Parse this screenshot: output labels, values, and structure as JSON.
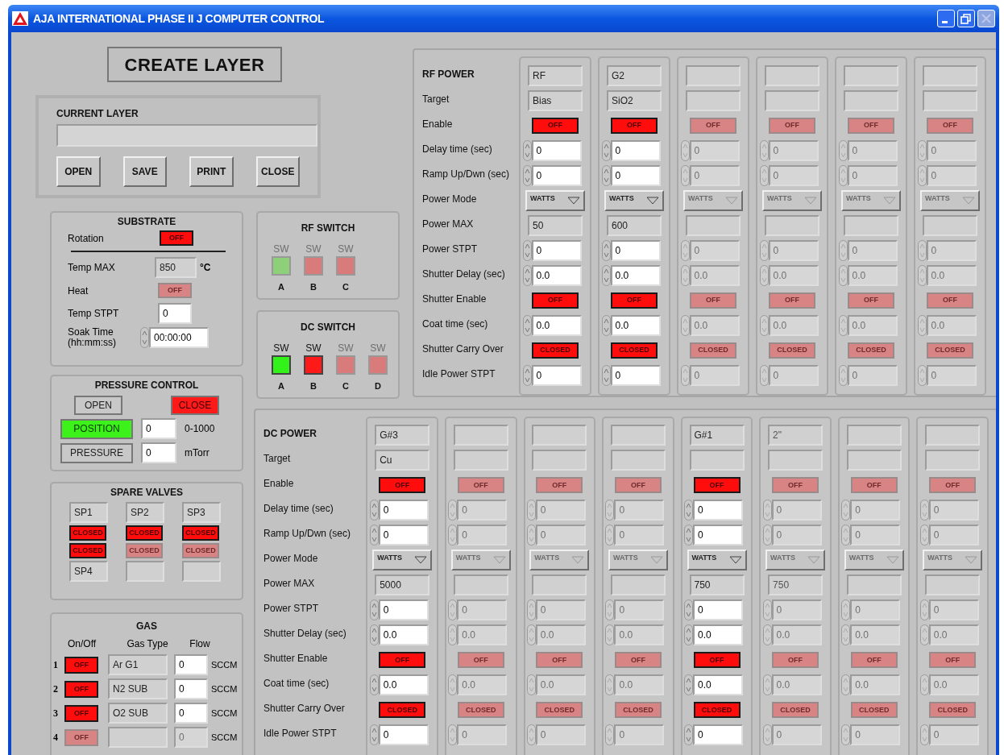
{
  "window": {
    "title": "AJA INTERNATIONAL PHASE II J COMPUTER CONTROL",
    "controls": [
      {
        "kind": "minimize",
        "enabled": true
      },
      {
        "kind": "restore",
        "enabled": true
      },
      {
        "kind": "close",
        "enabled": false
      }
    ]
  },
  "layer": {
    "title": "CREATE LAYER",
    "current_label": "CURRENT LAYER",
    "buttons": [
      "OPEN",
      "SAVE",
      "PRINT",
      "CLOSE"
    ]
  },
  "substrate": {
    "title": "SUBSTRATE",
    "rotation": {
      "label": "Rotation",
      "value": "OFF",
      "enabled": true
    },
    "temp_max": {
      "label": "Temp MAX",
      "value": "850",
      "unit": "°C"
    },
    "heat": {
      "label": "Heat",
      "value": "OFF",
      "enabled": false
    },
    "temp_stpt": {
      "label": "Temp STPT",
      "value": "0"
    },
    "soak_time": {
      "label": "Soak Time (hh:mm:ss)",
      "value": "00:00:00"
    }
  },
  "rf_switch": {
    "title": "RF SWITCH",
    "switches": [
      {
        "top": "SW",
        "letter": "A",
        "on": true,
        "enabled": false
      },
      {
        "top": "SW",
        "letter": "B",
        "on": false,
        "enabled": false
      },
      {
        "top": "SW",
        "letter": "C",
        "on": false,
        "enabled": false
      }
    ]
  },
  "dc_switch": {
    "title": "DC SWITCH",
    "switches": [
      {
        "top": "SW",
        "letter": "A",
        "on": true,
        "enabled": true
      },
      {
        "top": "SW",
        "letter": "B",
        "on": false,
        "enabled": true
      },
      {
        "top": "SW",
        "letter": "C",
        "on": false,
        "enabled": false
      },
      {
        "top": "SW",
        "letter": "D",
        "on": false,
        "enabled": false
      }
    ]
  },
  "pressure": {
    "title": "PRESSURE CONTROL",
    "valve_buttons": [
      {
        "label": "OPEN",
        "selected": false
      },
      {
        "label": "CLOSE",
        "selected": true
      }
    ],
    "modes": [
      {
        "label": "POSITION",
        "selected": true,
        "value": "0",
        "unit": "0-1000"
      },
      {
        "label": "PRESSURE",
        "selected": false,
        "value": "0",
        "unit": "mTorr"
      }
    ]
  },
  "spare_valves": {
    "title": "SPARE VALVES",
    "items": [
      {
        "kind": "field",
        "value": "SP1"
      },
      {
        "kind": "field",
        "value": "SP2"
      },
      {
        "kind": "field",
        "value": "SP3"
      },
      {
        "kind": "toggle",
        "value": "CLOSED",
        "enabled": true
      },
      {
        "kind": "toggle",
        "value": "CLOSED",
        "enabled": true
      },
      {
        "kind": "toggle",
        "value": "CLOSED",
        "enabled": true
      },
      {
        "kind": "toggle",
        "value": "CLOSED",
        "enabled": true
      },
      {
        "kind": "toggle",
        "value": "CLOSED",
        "enabled": false
      },
      {
        "kind": "toggle",
        "value": "CLOSED",
        "enabled": false
      },
      {
        "kind": "field",
        "value": "SP4"
      },
      {
        "kind": "field"
      },
      {
        "kind": "field"
      }
    ]
  },
  "gas": {
    "title": "GAS",
    "headers": [
      "On/Off",
      "Gas Type",
      "Flow"
    ],
    "rows": [
      {
        "number": "1",
        "switch": "OFF",
        "enabled": true,
        "gas_type": "Ar G1",
        "flow": "0",
        "unit": "SCCM"
      },
      {
        "number": "2",
        "switch": "OFF",
        "enabled": true,
        "gas_type": "N2 SUB",
        "flow": "0",
        "unit": "SCCM"
      },
      {
        "number": "3",
        "switch": "OFF",
        "enabled": true,
        "gas_type": "O2 SUB",
        "flow": "0",
        "unit": "SCCM"
      },
      {
        "number": "4",
        "switch": "OFF",
        "enabled": false,
        "flow": "0",
        "unit": "SCCM"
      }
    ]
  },
  "rf_power": {
    "rows": [
      {
        "label": "RF POWER",
        "kind": "name"
      },
      {
        "label": "Target",
        "kind": "text"
      },
      {
        "label": "Enable",
        "kind": "toggle"
      },
      {
        "label": "Delay time (sec)",
        "kind": "spin"
      },
      {
        "label": "Ramp Up/Dwn (sec)",
        "kind": "spin"
      },
      {
        "label": "Power Mode",
        "kind": "dropdown"
      },
      {
        "label": "Power MAX",
        "kind": "text"
      },
      {
        "label": "Power STPT",
        "kind": "spin"
      },
      {
        "label": "Shutter Delay (sec)",
        "kind": "spin"
      },
      {
        "label": "Shutter Enable",
        "kind": "toggle"
      },
      {
        "label": "Coat time (sec)",
        "kind": "spin"
      },
      {
        "label": "Shutter Carry Over",
        "kind": "toggle"
      },
      {
        "label": "Idle Power STPT",
        "kind": "spin"
      }
    ],
    "columns": [
      {
        "enabled": true,
        "name": "RF",
        "target": "Bias",
        "enable": "OFF",
        "delay": "0",
        "ramp": "0",
        "mode": "WATTS",
        "power_max": "50",
        "power_stpt": "0",
        "shutter_delay": "0.0",
        "shutter_enable": "OFF",
        "coat_time": "0.0",
        "carry_over": "CLOSED",
        "idle_stpt": "0"
      },
      {
        "enabled": true,
        "name": "G2",
        "target": "SiO2",
        "enable": "OFF",
        "delay": "0",
        "ramp": "0",
        "mode": "WATTS",
        "power_max": "600",
        "power_stpt": "0",
        "shutter_delay": "0.0",
        "shutter_enable": "OFF",
        "coat_time": "0.0",
        "carry_over": "CLOSED",
        "idle_stpt": "0"
      },
      {
        "enabled": false,
        "enable": "OFF",
        "delay": "0",
        "ramp": "0",
        "mode": "WATTS",
        "power_stpt": "0",
        "shutter_delay": "0.0",
        "shutter_enable": "OFF",
        "coat_time": "0.0",
        "carry_over": "CLOSED",
        "idle_stpt": "0"
      },
      {
        "enabled": false,
        "enable": "OFF",
        "delay": "0",
        "ramp": "0",
        "mode": "WATTS",
        "power_stpt": "0",
        "shutter_delay": "0.0",
        "shutter_enable": "OFF",
        "coat_time": "0.0",
        "carry_over": "CLOSED",
        "idle_stpt": "0"
      },
      {
        "enabled": false,
        "enable": "OFF",
        "delay": "0",
        "ramp": "0",
        "mode": "WATTS",
        "power_stpt": "0",
        "shutter_delay": "0.0",
        "shutter_enable": "OFF",
        "coat_time": "0.0",
        "carry_over": "CLOSED",
        "idle_stpt": "0"
      },
      {
        "enabled": false,
        "enable": "OFF",
        "delay": "0",
        "ramp": "0",
        "mode": "WATTS",
        "power_stpt": "0",
        "shutter_delay": "0.0",
        "shutter_enable": "OFF",
        "coat_time": "0.0",
        "carry_over": "CLOSED",
        "idle_stpt": "0"
      }
    ]
  },
  "dc_power": {
    "rows": [
      {
        "label": "DC POWER",
        "kind": "name"
      },
      {
        "label": "Target",
        "kind": "text"
      },
      {
        "label": "Enable",
        "kind": "toggle"
      },
      {
        "label": "Delay time (sec)",
        "kind": "spin"
      },
      {
        "label": "Ramp Up/Dwn (sec)",
        "kind": "spin"
      },
      {
        "label": "Power Mode",
        "kind": "dropdown"
      },
      {
        "label": "Power MAX",
        "kind": "text"
      },
      {
        "label": "Power STPT",
        "kind": "spin"
      },
      {
        "label": "Shutter Delay (sec)",
        "kind": "spin"
      },
      {
        "label": "Shutter Enable",
        "kind": "toggle"
      },
      {
        "label": "Coat time (sec)",
        "kind": "spin"
      },
      {
        "label": "Shutter Carry Over",
        "kind": "toggle"
      },
      {
        "label": "Idle Power STPT",
        "kind": "spin"
      }
    ],
    "columns": [
      {
        "enabled": true,
        "name": "G#3",
        "target": "Cu",
        "enable": "OFF",
        "delay": "0",
        "ramp": "0",
        "mode": "WATTS",
        "power_max": "5000",
        "power_stpt": "0",
        "shutter_delay": "0.0",
        "shutter_enable": "OFF",
        "coat_time": "0.0",
        "carry_over": "CLOSED",
        "idle_stpt": "0"
      },
      {
        "enabled": false,
        "enable": "OFF",
        "delay": "0",
        "ramp": "0",
        "mode": "WATTS",
        "power_stpt": "0",
        "shutter_delay": "0.0",
        "shutter_enable": "OFF",
        "coat_time": "0.0",
        "carry_over": "CLOSED",
        "idle_stpt": "0"
      },
      {
        "enabled": false,
        "enable": "OFF",
        "delay": "0",
        "ramp": "0",
        "mode": "WATTS",
        "power_stpt": "0",
        "shutter_delay": "0.0",
        "shutter_enable": "OFF",
        "coat_time": "0.0",
        "carry_over": "CLOSED",
        "idle_stpt": "0"
      },
      {
        "enabled": false,
        "enable": "OFF",
        "delay": "0",
        "ramp": "0",
        "mode": "WATTS",
        "power_stpt": "0",
        "shutter_delay": "0.0",
        "shutter_enable": "OFF",
        "coat_time": "0.0",
        "carry_over": "CLOSED",
        "idle_stpt": "0"
      },
      {
        "enabled": true,
        "name": "G#1",
        "enable": "OFF",
        "delay": "0",
        "ramp": "0",
        "mode": "WATTS",
        "power_max": "750",
        "power_stpt": "0",
        "shutter_delay": "0.0",
        "shutter_enable": "OFF",
        "coat_time": "0.0",
        "carry_over": "CLOSED",
        "idle_stpt": "0"
      },
      {
        "enabled": false,
        "name": "2\"",
        "enable": "OFF",
        "delay": "0",
        "ramp": "0",
        "mode": "WATTS",
        "power_max": "750",
        "power_stpt": "0",
        "shutter_delay": "0.0",
        "shutter_enable": "OFF",
        "coat_time": "0.0",
        "carry_over": "CLOSED",
        "idle_stpt": "0"
      },
      {
        "enabled": false,
        "enable": "OFF",
        "delay": "0",
        "ramp": "0",
        "mode": "WATTS",
        "power_stpt": "0",
        "shutter_delay": "0.0",
        "shutter_enable": "OFF",
        "coat_time": "0.0",
        "carry_over": "CLOSED",
        "idle_stpt": "0"
      },
      {
        "enabled": false,
        "enable": "OFF",
        "delay": "0",
        "ramp": "0",
        "mode": "WATTS",
        "power_stpt": "0",
        "shutter_delay": "0.0",
        "shutter_enable": "OFF",
        "coat_time": "0.0",
        "carry_over": "CLOSED",
        "idle_stpt": "0"
      }
    ]
  }
}
